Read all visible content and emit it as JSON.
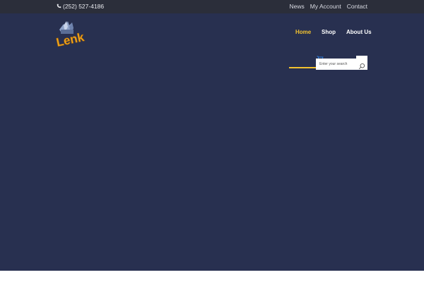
{
  "topbar": {
    "phone": "(252) 527-4186",
    "links": [
      "News",
      "My Account",
      "Contact"
    ]
  },
  "brand": {
    "logo_text": "Lenk",
    "logo_color": "#f2a81e"
  },
  "nav": {
    "items": [
      "Home",
      "Shop",
      "About Us"
    ],
    "active": "Home",
    "accent": "#f2c230"
  },
  "search": {
    "placeholder": "Enter your search"
  },
  "colors": {
    "topbar": "#2b2e3a",
    "hero": "#283050"
  }
}
